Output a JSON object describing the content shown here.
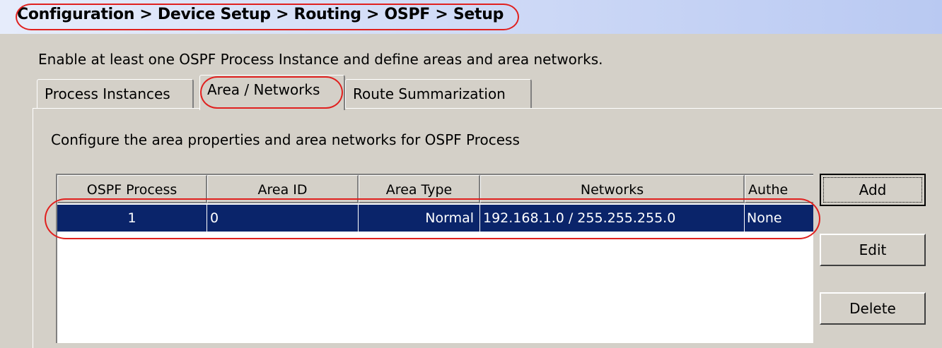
{
  "breadcrumb": "Configuration > Device Setup > Routing > OSPF > Setup",
  "intro_text": "Enable at least one OSPF Process Instance and define areas and area networks.",
  "tabs": [
    {
      "label": "Process Instances",
      "active": false
    },
    {
      "label": "Area / Networks",
      "active": true
    },
    {
      "label": "Route Summarization",
      "active": false
    }
  ],
  "panel_description": "Configure the area properties and area networks for OSPF Process",
  "table": {
    "columns": [
      "OSPF Process",
      "Area ID",
      "Area Type",
      "Networks",
      "Authe"
    ],
    "rows": [
      [
        "1",
        "0",
        "Normal",
        "192.168.1.0 / 255.255.255.0",
        "None"
      ]
    ],
    "selected_row_color": "#0a246a"
  },
  "buttons": {
    "add": "Add",
    "edit": "Edit",
    "delete": "Delete"
  },
  "colors": {
    "highlight_circle": "#e0201e",
    "window_bg": "#d4d0c8"
  }
}
